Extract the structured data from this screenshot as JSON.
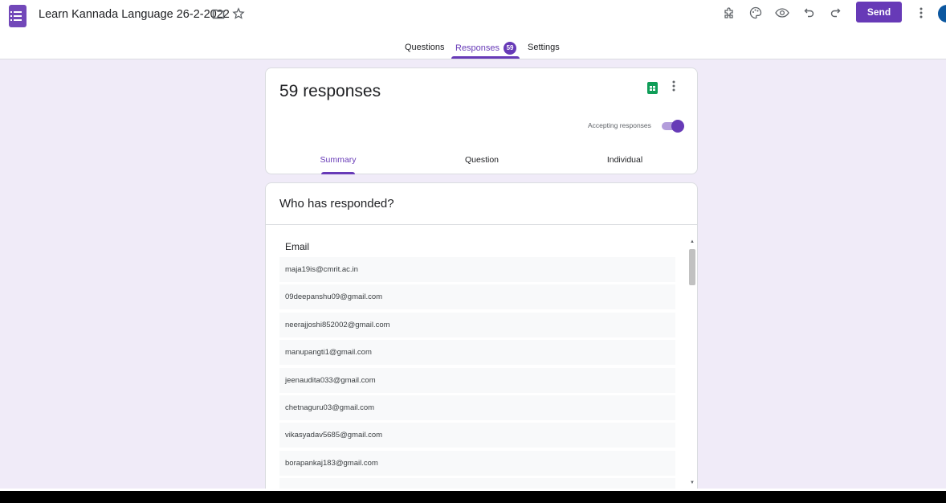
{
  "header": {
    "title": "Learn Kannada Language 26-2-2022",
    "send_label": "Send"
  },
  "tabs": {
    "questions": "Questions",
    "responses": "Responses",
    "responses_count": "59",
    "settings": "Settings"
  },
  "summary_card": {
    "response_count_label": "59 responses",
    "accepting_label": "Accepting responses",
    "accepting_on": true,
    "sub_tabs": {
      "summary": "Summary",
      "question": "Question",
      "individual": "Individual"
    }
  },
  "who_card": {
    "title": "Who has responded?",
    "column_header": "Email",
    "emails": [
      "maja19is@cmrit.ac.in",
      "09deepanshu09@gmail.com",
      "neerajjoshi852002@gmail.com",
      "manupangti1@gmail.com",
      "jeenaudita033@gmail.com",
      "chetnaguru03@gmail.com",
      "vikasyadav5685@gmail.com",
      "borapankaj183@gmail.com"
    ]
  },
  "colors": {
    "accent": "#673ab7",
    "background": "#f0ebf8",
    "sheets_green": "#0f9d58"
  }
}
